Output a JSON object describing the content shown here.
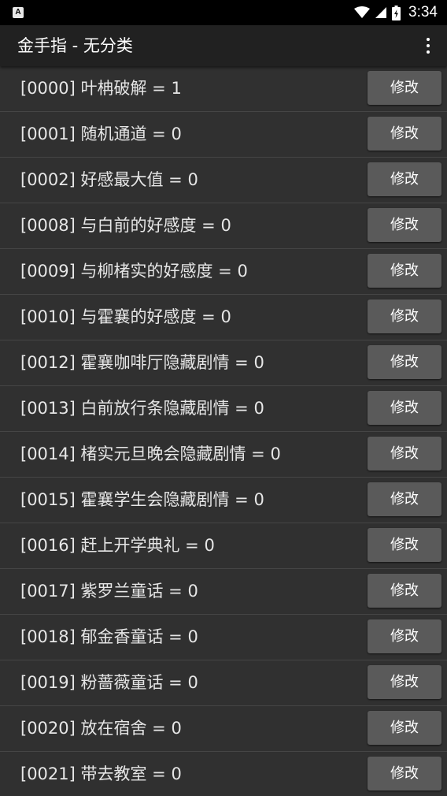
{
  "status_bar": {
    "time": "3:34",
    "notification_glyph": "A",
    "icons": [
      "wifi-icon",
      "signal-icon",
      "battery-icon"
    ]
  },
  "app_bar": {
    "title": "金手指 - 无分类",
    "menu_icon": "overflow-menu-icon"
  },
  "colors": {
    "background": "#303030",
    "app_bar": "#212121",
    "button": "#5a5a5a",
    "divider": "#454545"
  },
  "items": [
    {
      "label": "[0000] 叶柟破解 = 1",
      "button": "修改"
    },
    {
      "label": "[0001] 随机通道 = 0",
      "button": "修改"
    },
    {
      "label": "[0002] 好感最大值 = 0",
      "button": "修改"
    },
    {
      "label": "[0008] 与白前的好感度 = 0",
      "button": "修改"
    },
    {
      "label": "[0009] 与柳楮实的好感度 = 0",
      "button": "修改"
    },
    {
      "label": "[0010] 与霍襄的好感度 = 0",
      "button": "修改"
    },
    {
      "label": "[0012] 霍襄咖啡厅隐藏剧情 = 0",
      "button": "修改"
    },
    {
      "label": "[0013] 白前放行条隐藏剧情 = 0",
      "button": "修改"
    },
    {
      "label": "[0014] 楮实元旦晚会隐藏剧情 = 0",
      "button": "修改"
    },
    {
      "label": "[0015] 霍襄学生会隐藏剧情 = 0",
      "button": "修改"
    },
    {
      "label": "[0016] 赶上开学典礼 = 0",
      "button": "修改"
    },
    {
      "label": "[0017] 紫罗兰童话 = 0",
      "button": "修改"
    },
    {
      "label": "[0018] 郁金香童话 = 0",
      "button": "修改"
    },
    {
      "label": "[0019] 粉蔷薇童话 = 0",
      "button": "修改"
    },
    {
      "label": "[0020] 放在宿舍 = 0",
      "button": "修改"
    },
    {
      "label": "[0021] 带去教室 = 0",
      "button": "修改"
    }
  ]
}
